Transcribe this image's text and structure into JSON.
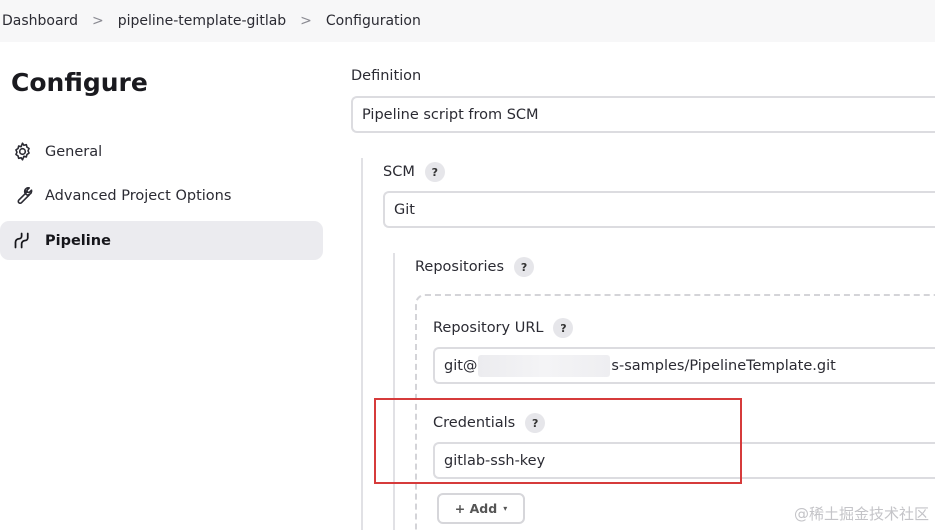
{
  "breadcrumb": {
    "items": [
      "Dashboard",
      "pipeline-template-gitlab",
      "Configuration"
    ],
    "separator": ">"
  },
  "sidebar": {
    "title": "Configure",
    "items": [
      {
        "label": "General",
        "icon": "gear-icon",
        "active": false
      },
      {
        "label": "Advanced Project Options",
        "icon": "wrench-icon",
        "active": false
      },
      {
        "label": "Pipeline",
        "icon": "pipeline-icon",
        "active": true
      }
    ]
  },
  "main": {
    "definition": {
      "label": "Definition",
      "value": "Pipeline script from SCM"
    },
    "scm": {
      "label": "SCM",
      "help": "?",
      "value": "Git"
    },
    "repositories": {
      "label": "Repositories",
      "help": "?"
    },
    "repository_url": {
      "label": "Repository URL",
      "help": "?",
      "value_prefix": "git@",
      "value_suffix": "s-samples/PipelineTemplate.git"
    },
    "credentials": {
      "label": "Credentials",
      "help": "?",
      "value": "gitlab-ssh-key"
    },
    "add_button": {
      "label": "+ Add",
      "caret": "▾"
    }
  },
  "watermark": "@稀土掘金技术社区",
  "colors": {
    "highlight": "#d63b3b",
    "active_bg": "#ebebef",
    "breadcrumb_bg": "#f7f7f8"
  }
}
